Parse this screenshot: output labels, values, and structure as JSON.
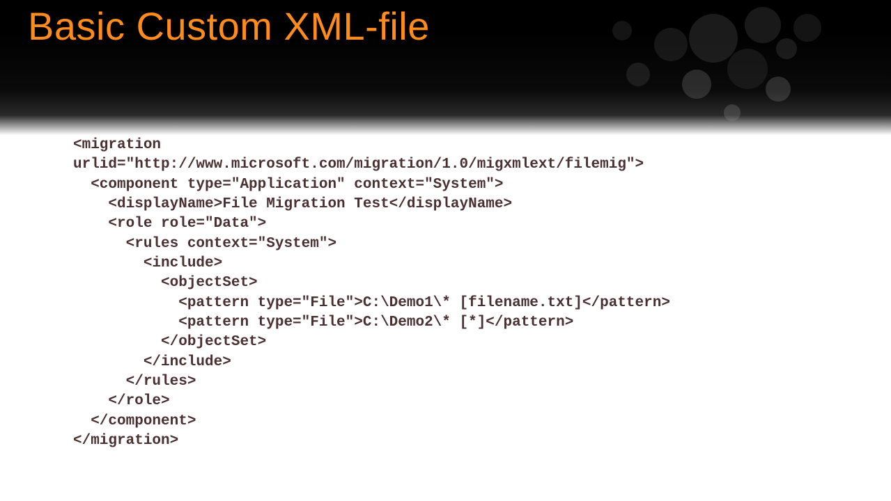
{
  "title": "Basic Custom XML-file",
  "code": {
    "l01": "<migration",
    "l02": "urlid=\"http://www.microsoft.com/migration/1.0/migxmlext/filemig\">",
    "l03": "  <component type=\"Application\" context=\"System\">",
    "l04": "    <displayName>File Migration Test</displayName>",
    "l05": "    <role role=\"Data\">",
    "l06": "      <rules context=\"System\">",
    "l07": "        <include>",
    "l08": "          <objectSet>",
    "l09": "            <pattern type=\"File\">C:\\Demo1\\* [filename.txt]</pattern>",
    "l10": "            <pattern type=\"File\">C:\\Demo2\\* [*]</pattern>",
    "l11": "          </objectSet>",
    "l12": "        </include>",
    "l13": "      </rules>",
    "l14": "    </role>",
    "l15": "  </component>",
    "l16": "</migration>"
  }
}
